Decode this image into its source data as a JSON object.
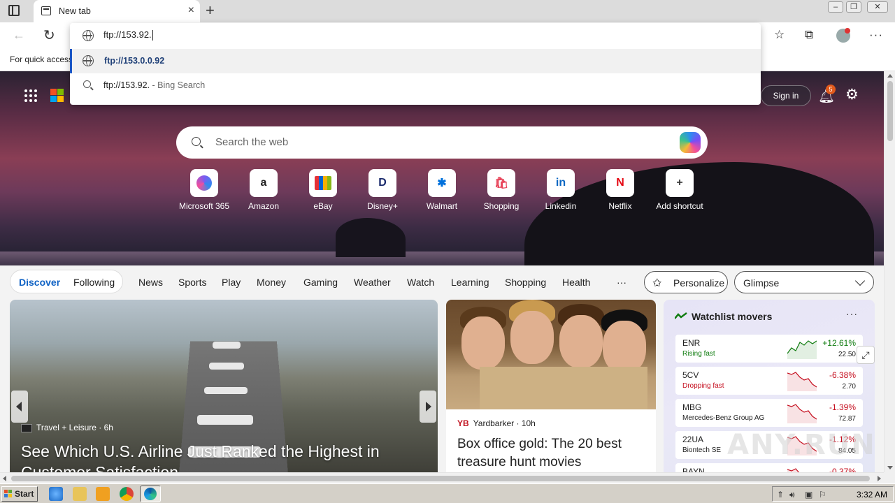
{
  "browser": {
    "tab_title": "New tab",
    "tab_close": "×",
    "new_tab": "+",
    "window_controls": [
      "–",
      "❐",
      "✕"
    ],
    "favbar_text": "For quick access"
  },
  "omnibox": {
    "input": "ftp://153.92.",
    "suggestions": [
      {
        "icon": "globe-icon",
        "text": "ftp://153.0.0.92"
      },
      {
        "icon": "search-icon",
        "text": "ftp://153.92.",
        "hint": " - Bing Search"
      }
    ]
  },
  "header": {
    "signin": "Sign in",
    "notification_count": "5"
  },
  "search": {
    "placeholder": "Search the web"
  },
  "shortcuts": [
    {
      "label": "Microsoft 365",
      "glyph": "",
      "color": "#7b5cf0"
    },
    {
      "label": "Amazon",
      "glyph": "a",
      "color": "#222222"
    },
    {
      "label": "eBay",
      "glyph": "",
      "color": "#e53238"
    },
    {
      "label": "Disney+",
      "glyph": "D",
      "color": "#1a2a6c"
    },
    {
      "label": "Walmart",
      "glyph": "✱",
      "color": "#0071dc"
    },
    {
      "label": "Shopping",
      "glyph": "🛍",
      "color": "#e8445a"
    },
    {
      "label": "Linkedin",
      "glyph": "in",
      "color": "#0a66c2"
    },
    {
      "label": "Netflix",
      "glyph": "N",
      "color": "#e50914"
    },
    {
      "label": "Add shortcut",
      "glyph": "+",
      "color": "#333333"
    }
  ],
  "feed_nav": {
    "discover": "Discover",
    "following": "Following",
    "items": [
      "News",
      "Sports",
      "Play",
      "Money",
      "Gaming",
      "Weather",
      "Watch",
      "Learning",
      "Shopping",
      "Health",
      "···"
    ],
    "personalize": "Personalize",
    "glimpse": "Glimpse"
  },
  "main_card": {
    "source": "Travel + Leisure · 6h",
    "title": "See Which U.S. Airline Just Ranked the Highest in Customer Satisfaction"
  },
  "mid_card": {
    "source_logo": "YB",
    "source": "Yardbarker · 10h",
    "title": "Box office gold: The 20 best treasure hunt movies"
  },
  "watchlist": {
    "title": "Watchlist movers",
    "more": "···",
    "stocks": [
      {
        "symbol": "ENR",
        "sub": "Rising fast",
        "pct": "+12.61%",
        "price": "22.50",
        "trend": "up"
      },
      {
        "symbol": "5CV",
        "sub": "Dropping fast",
        "pct": "-6.38%",
        "price": "2.70",
        "trend": "down"
      },
      {
        "symbol": "MBG",
        "sub": "Mercedes-Benz Group AG",
        "pct": "-1.39%",
        "price": "72.87",
        "trend": "down"
      },
      {
        "symbol": "22UA",
        "sub": "Biontech SE",
        "pct": "-1.12%",
        "price": "84.05",
        "trend": "down"
      },
      {
        "symbol": "BAYN",
        "sub": "",
        "pct": "-0.37%",
        "price": "",
        "trend": "down"
      }
    ]
  },
  "colors": {
    "up": "#107c10",
    "down": "#c50f1f",
    "accent": "#0f62c4"
  },
  "watermark": "ANY.RUN",
  "taskbar": {
    "start": "Start",
    "clock": "3:32 AM"
  }
}
